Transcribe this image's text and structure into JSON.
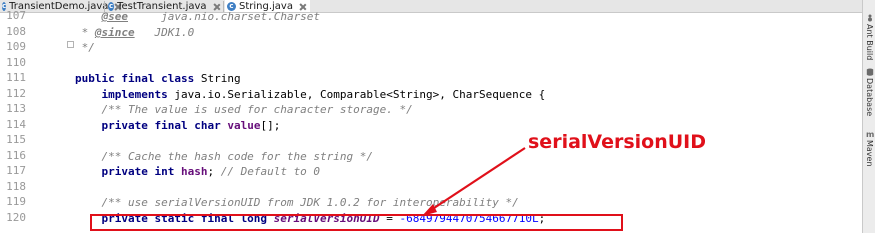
{
  "tabs": [
    {
      "label": "TransientDemo.java",
      "icon": "java-class-icon",
      "active": false
    },
    {
      "label": "TestTransient.java",
      "icon": "java-class-icon",
      "active": false
    },
    {
      "label": "String.java",
      "icon": "java-class-icon",
      "active": true
    }
  ],
  "gutter": {
    "line_numbers": [
      "107",
      "108",
      "109",
      "110",
      "111",
      "112",
      "113",
      "114",
      "115",
      "116",
      "117",
      "118",
      "119",
      "120"
    ]
  },
  "code": {
    "l107_tag": "@see",
    "l107_text": "     java.nio.charset.Charset",
    "l108_star": " * ",
    "l108_tag": "@since",
    "l108_text": "   JDK1.0",
    "l109": " */",
    "l111_kw": "public final class",
    "l111_name": " String",
    "l112_kw": "    implements",
    "l112_text": " java.io.Serializable, Comparable<String>, CharSequence {",
    "l113": "    /** The value is used for character storage. */",
    "l114_kw": "    private final char",
    "l114_field": " value",
    "l114_rest": "[];",
    "l116": "    /** Cache the hash code for the string */",
    "l117_kw": "    private int",
    "l117_field": " hash",
    "l117_semi": ";",
    "l117_cm": " // Default to 0",
    "l119": "    /** use serialVersionUID from JDK 1.0.2 for interoperability */",
    "l120_kw": "    private static final long",
    "l120_field": " serialVersionUID",
    "l120_eq": " = ",
    "l120_num": "-6849794470754667710L",
    "l120_semi": ";"
  },
  "annotation": {
    "label": "serialVersionUID",
    "color": "#e0101a"
  },
  "toolstrip": [
    {
      "label": "Ant Build",
      "icon": "ant-icon"
    },
    {
      "label": "Database",
      "icon": "database-icon"
    },
    {
      "label": "Maven",
      "icon": "maven-icon"
    }
  ],
  "colors": {
    "keyword": "#000080",
    "comment": "#808080",
    "field": "#660e7a",
    "number": "#0000ff",
    "line_number": "#999999"
  }
}
